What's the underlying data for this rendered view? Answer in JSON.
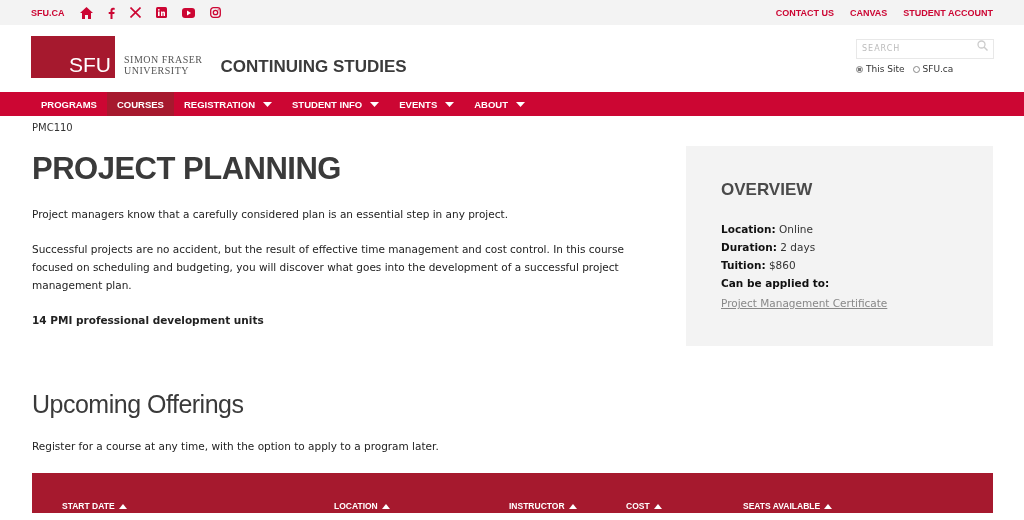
{
  "top_bar": {
    "site_link": "SFU.CA",
    "links": [
      "CONTACT US",
      "CANVAS",
      "STUDENT ACCOUNT"
    ]
  },
  "header": {
    "logo_text": "SFU",
    "university_name": [
      "SIMON FRASER",
      "UNIVERSITY"
    ],
    "site_title": "CONTINUING STUDIES",
    "search": {
      "placeholder": "SEARCH"
    },
    "scope_options": [
      {
        "label": "This Site",
        "selected": true
      },
      {
        "label": "SFU.ca",
        "selected": false
      }
    ]
  },
  "nav": [
    {
      "label": "PROGRAMS",
      "selected": false,
      "dropdown": false
    },
    {
      "label": "COURSES",
      "selected": true,
      "dropdown": false
    },
    {
      "label": "REGISTRATION",
      "selected": false,
      "dropdown": true
    },
    {
      "label": "STUDENT INFO",
      "selected": false,
      "dropdown": true
    },
    {
      "label": "EVENTS",
      "selected": false,
      "dropdown": true
    },
    {
      "label": "ABOUT",
      "selected": false,
      "dropdown": true
    }
  ],
  "breadcrumb": "PMC110",
  "course": {
    "title": "PROJECT PLANNING",
    "paragraphs": [
      "Project managers know that a carefully considered plan is an essential step in any project.",
      "Successful projects are no accident, but the result of effective time management and cost control. In this course focused on scheduling and budgeting, you will discover what goes into the development of a successful project management plan."
    ],
    "units": "14 PMI professional development units"
  },
  "overview": {
    "title": "OVERVIEW",
    "facts": [
      {
        "label": "Location:",
        "value": "Online"
      },
      {
        "label": "Duration:",
        "value": "2 days"
      },
      {
        "label": "Tuition:",
        "value": "$860"
      }
    ],
    "applied_label": "Can be applied to:",
    "applied_link": "Project Management Certificate"
  },
  "offerings": {
    "title": "Upcoming Offerings",
    "intro": "Register for a course at any time, with the option to apply to a program later.",
    "columns": [
      "START DATE",
      "LOCATION",
      "INSTRUCTOR",
      "COST",
      "SEATS AVAILABLE"
    ]
  }
}
